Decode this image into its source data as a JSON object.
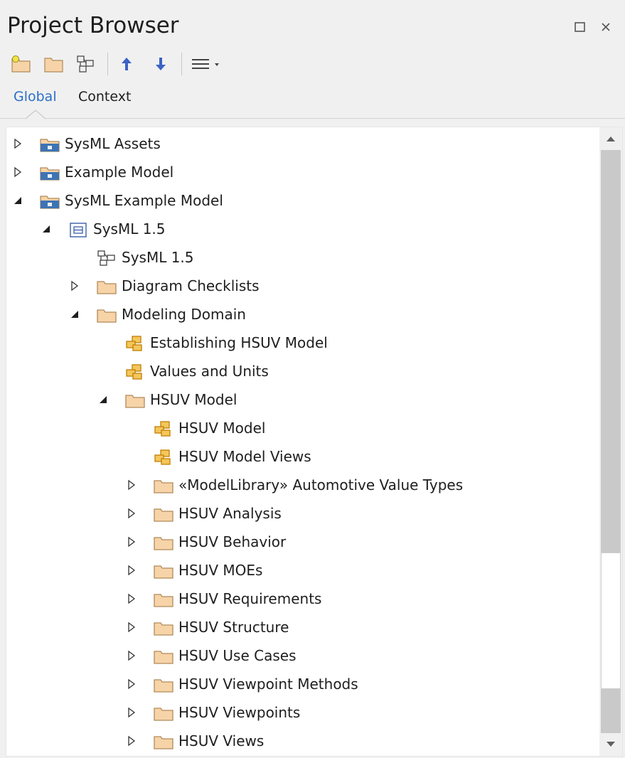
{
  "window": {
    "title": "Project Browser",
    "maximize_icon": "maximize-icon",
    "close_icon": "close-icon"
  },
  "toolbar": {
    "buttons": [
      {
        "name": "new-model-icon"
      },
      {
        "name": "new-package-icon"
      },
      {
        "name": "new-diagram-icon"
      },
      {
        "name": "move-up-icon"
      },
      {
        "name": "move-down-icon"
      },
      {
        "name": "menu-icon"
      }
    ]
  },
  "tabs": {
    "global": "Global",
    "context": "Context",
    "active": "global"
  },
  "colors": {
    "accent_blue": "#2b6fc6",
    "folder_fill": "#f7d3a8",
    "folder_stroke": "#b08a5a",
    "model_blue": "#3d74b5",
    "diagram_gold": "#e8a21a"
  },
  "tree": {
    "items": [
      {
        "label": "SysML Assets",
        "expanded": false,
        "icon": "model-root-icon"
      },
      {
        "label": "Example Model",
        "expanded": false,
        "icon": "model-root-icon"
      },
      {
        "label": "SysML Example Model",
        "expanded": true,
        "icon": "model-root-icon"
      },
      {
        "label": "SysML 1.5",
        "expanded": true,
        "icon": "package-view-icon"
      },
      {
        "label": "SysML 1.5",
        "expanded": null,
        "icon": "diagram-icon"
      },
      {
        "label": "Diagram Checklists",
        "expanded": false,
        "icon": "folder-icon"
      },
      {
        "label": "Modeling Domain",
        "expanded": true,
        "icon": "folder-icon"
      },
      {
        "label": "Establishing HSUV Model",
        "expanded": null,
        "icon": "package-diagram-icon"
      },
      {
        "label": "Values and Units",
        "expanded": null,
        "icon": "package-diagram-icon"
      },
      {
        "label": "HSUV Model",
        "expanded": true,
        "icon": "folder-icon"
      },
      {
        "label": "HSUV Model",
        "expanded": null,
        "icon": "package-diagram-icon"
      },
      {
        "label": "HSUV Model Views",
        "expanded": null,
        "icon": "package-diagram-icon"
      },
      {
        "label": "«ModelLibrary» Automotive Value Types",
        "expanded": false,
        "icon": "folder-icon"
      },
      {
        "label": "HSUV Analysis",
        "expanded": false,
        "icon": "folder-icon"
      },
      {
        "label": "HSUV Behavior",
        "expanded": false,
        "icon": "folder-icon"
      },
      {
        "label": "HSUV MOEs",
        "expanded": false,
        "icon": "folder-icon"
      },
      {
        "label": "HSUV Requirements",
        "expanded": false,
        "icon": "folder-icon"
      },
      {
        "label": "HSUV Structure",
        "expanded": false,
        "icon": "folder-icon"
      },
      {
        "label": "HSUV Use Cases",
        "expanded": false,
        "icon": "folder-icon"
      },
      {
        "label": "HSUV Viewpoint Methods",
        "expanded": false,
        "icon": "folder-icon"
      },
      {
        "label": "HSUV Viewpoints",
        "expanded": false,
        "icon": "folder-icon"
      },
      {
        "label": "HSUV Views",
        "expanded": false,
        "icon": "folder-icon"
      }
    ]
  },
  "scrollbar": {
    "up_icon": "scroll-up-icon",
    "down_icon": "scroll-down-icon"
  }
}
